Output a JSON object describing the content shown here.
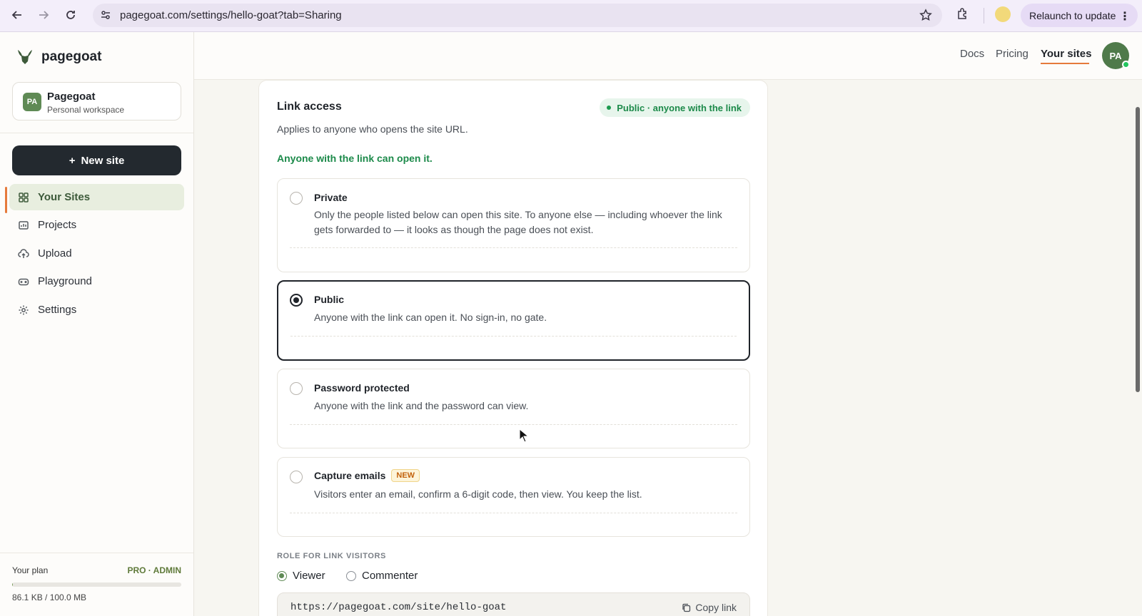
{
  "browser": {
    "url": "pagegoat.com/settings/hello-goat?tab=Sharing",
    "relaunch_label": "Relaunch to update"
  },
  "sidebar": {
    "brand_name": "pagegoat",
    "workspace": {
      "avatar": "PA",
      "name": "Pagegoat",
      "subtitle": "Personal workspace"
    },
    "new_site_label": "New site",
    "items": [
      {
        "label": "Your Sites",
        "icon": "grid-icon",
        "active": true
      },
      {
        "label": "Projects",
        "icon": "chart-icon",
        "active": false
      },
      {
        "label": "Upload",
        "icon": "upload-cloud-icon",
        "active": false
      },
      {
        "label": "Playground",
        "icon": "gamepad-icon",
        "active": false
      },
      {
        "label": "Settings",
        "icon": "gear-icon",
        "active": false
      }
    ],
    "plan": {
      "label": "Your plan",
      "tier": "PRO · ADMIN",
      "usage": "86.1 KB / 100.0 MB",
      "fraction_used": 0.001
    }
  },
  "topnav": {
    "links": [
      "Docs",
      "Pricing",
      "Your sites"
    ],
    "active": "Your sites",
    "avatar": "PA"
  },
  "link_access": {
    "title": "Link access",
    "status": "Public · anyone with the link",
    "subtitle": "Applies to anyone who opens the site URL.",
    "note": "Anyone with the link can open it.",
    "options": [
      {
        "title": "Private",
        "description": "Only the people listed below can open this site. To anyone else — including whoever the link gets forwarded to — it looks as though the page does not exist.",
        "selected": false
      },
      {
        "title": "Public",
        "description": "Anyone with the link can open it. No sign-in, no gate.",
        "selected": true
      },
      {
        "title": "Password protected",
        "description": "Anyone with the link and the password can view.",
        "selected": false
      },
      {
        "title": "Capture emails",
        "badge": "NEW",
        "description": "Visitors enter an email, confirm a 6-digit code, then view. You keep the list.",
        "selected": false
      }
    ],
    "role": {
      "label": "ROLE FOR LINK VISITORS",
      "options": [
        "Viewer",
        "Commenter"
      ],
      "selected": "Viewer"
    },
    "link_url": "https://pagegoat.com/site/hello-goat",
    "copy_label": "Copy link"
  },
  "colors": {
    "accent_orange": "#e67a3c",
    "brand_green": "#3d5a3a",
    "status_green": "#1c8a4a",
    "dark_button": "#23292f"
  }
}
